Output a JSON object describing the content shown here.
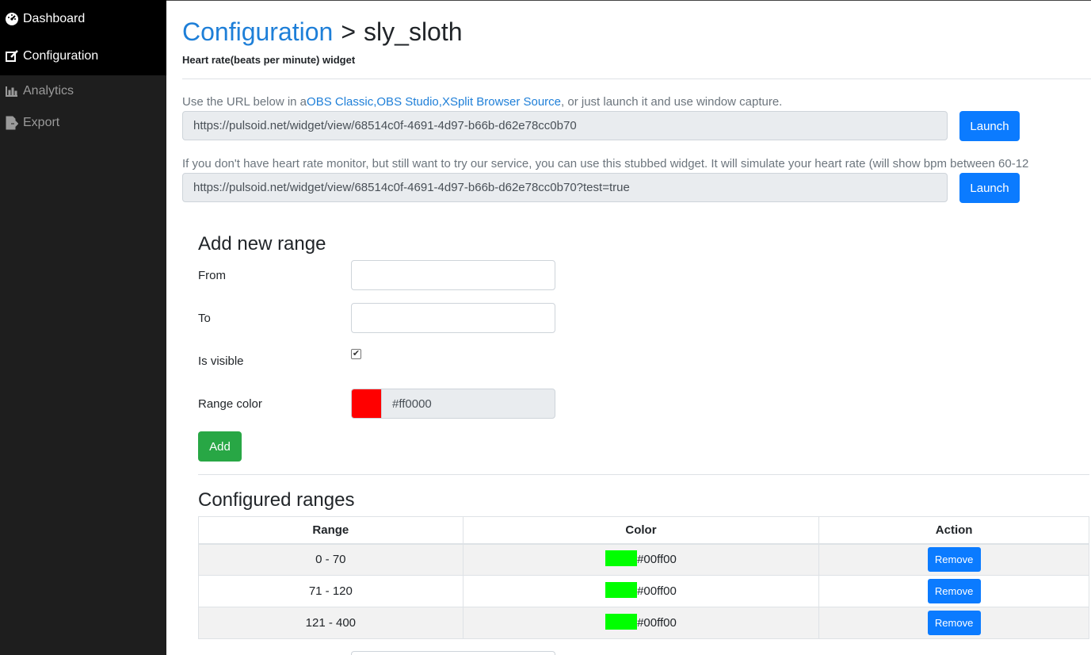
{
  "sidebar": {
    "items": [
      {
        "label": "Dashboard",
        "icon": "tachometer-icon"
      },
      {
        "label": "Configuration",
        "icon": "edit-icon"
      },
      {
        "label": "Analytics",
        "icon": "bar-chart-icon"
      },
      {
        "label": "Export",
        "icon": "file-export-icon"
      }
    ]
  },
  "header": {
    "breadcrumb_link": "Configuration",
    "separator": ">",
    "current": "sly_sloth",
    "subtitle": "Heart rate(beats per minute) widget"
  },
  "widget_url": {
    "hint_prefix": "Use the URL below in a",
    "link1": "OBS Classic",
    "link2": "OBS Studio",
    "link3": "XSplit Browser Source",
    "comma": ",",
    "hint_suffix": ", or just launch it and use window capture.",
    "url": "https://pulsoid.net/widget/view/68514c0f-4691-4d97-b66b-d62e78cc0b70",
    "launch_label": "Launch"
  },
  "test_url": {
    "hint": "If you don't have heart rate monitor, but still want to try our service, you can use this stubbed widget. It will simulate your heart rate (will show bpm between 60-12",
    "url": "https://pulsoid.net/widget/view/68514c0f-4691-4d97-b66b-d62e78cc0b70?test=true",
    "launch_label": "Launch"
  },
  "add_range": {
    "heading": "Add new range",
    "from_label": "From",
    "to_label": "To",
    "visible_label": "Is visible",
    "visible_checked": true,
    "color_label": "Range color",
    "color_value": "#ff0000",
    "add_label": "Add"
  },
  "configured": {
    "heading": "Configured ranges",
    "columns": [
      "Range",
      "Color",
      "Action"
    ],
    "rows": [
      {
        "range": "0 - 70",
        "color": "#00ff00",
        "action": "Remove"
      },
      {
        "range": "71 - 120",
        "color": "#00ff00",
        "action": "Remove"
      },
      {
        "range": "121 - 400",
        "color": "#00ff00",
        "action": "Remove"
      }
    ]
  },
  "colors": {
    "sidebar_bg": "#1e1e1e",
    "primary": "#0b7bff",
    "success": "#28a745",
    "link": "#1e7fd8"
  }
}
